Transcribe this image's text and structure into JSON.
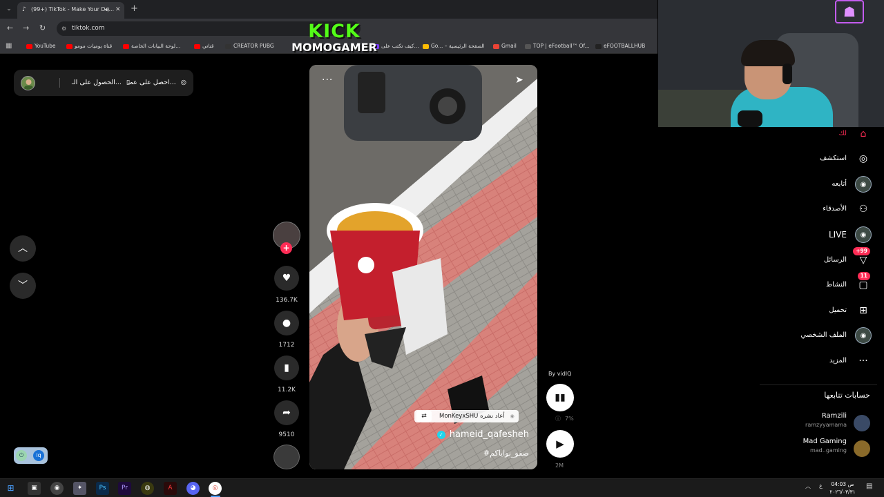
{
  "browser": {
    "tab_title": "(99+) TikTok - Make Your Da...",
    "url": "tiktok.com",
    "bookmarks": [
      {
        "label": "YouTube",
        "color": "#ff0000"
      },
      {
        "label": "قناة يوميات مومو",
        "color": "#ff0000"
      },
      {
        "label": "لوحة البيانات الخاصة...",
        "color": "#ff0000"
      },
      {
        "label": "قناتي",
        "color": "#ff0000"
      },
      {
        "label": "CREATOR PUBG",
        "color": "#333333"
      },
      {
        "label": "كيف تكتب على...",
        "color": "#7a3cff"
      },
      {
        "label": "Go... – الصفحة الرئيسية",
        "color": "#fbbc04"
      },
      {
        "label": "Gmail",
        "color": "#ea4335"
      },
      {
        "label": "TOP | eFootball™ Of...",
        "color": "#555555"
      },
      {
        "label": "eFOOTBALLHUB",
        "color": "#222222"
      }
    ]
  },
  "overlay": {
    "line1": "KICK",
    "line2": "MOMOGAMER"
  },
  "topbar": {
    "item1": "احصل على عمـ...",
    "item2": "الحصول على الـ..."
  },
  "video": {
    "repost_text": "MonKeyxSHU أعاد نشره",
    "author": "hameid_qafesheh",
    "hashtag": "#صفو_نواياكم"
  },
  "actions": {
    "likes": "136.7K",
    "comments": "1712",
    "saves": "11.2K",
    "shares": "9510"
  },
  "vidiq": {
    "label": "By vidIQ",
    "percent": "7%",
    "views": "2M"
  },
  "sidebar": {
    "items": [
      {
        "label": "لك",
        "icon": "home-icon",
        "active": true
      },
      {
        "label": "استكشف",
        "icon": "compass-icon"
      },
      {
        "label": "أتابعه",
        "icon": "following-avatar-icon"
      },
      {
        "label": "الأصدقاء",
        "icon": "friends-icon"
      },
      {
        "label": "LIVE",
        "icon": "live-avatar-icon"
      },
      {
        "label": "الرسائل",
        "icon": "messages-icon",
        "badge": "+99"
      },
      {
        "label": "النشاط",
        "icon": "activity-icon",
        "badge": "11"
      },
      {
        "label": "تحميل",
        "icon": "upload-icon"
      },
      {
        "label": "الملف الشخصي",
        "icon": "profile-avatar-icon"
      },
      {
        "label": "المزيد",
        "icon": "more-icon"
      }
    ],
    "following_title": "حسابات تتابعها",
    "following": [
      {
        "name": "Ramzili",
        "handle": "ramzyyamama"
      },
      {
        "name": "Mad Gaming",
        "handle": "mad..gaming"
      }
    ]
  },
  "taskbar": {
    "time": "04:03 ص",
    "date": "٢٠٢٦/٠٣/٣١",
    "lang": "ع"
  },
  "colors": {
    "accent": "#fe2c55",
    "kick": "#53fc18",
    "verified": "#20d5ec"
  }
}
